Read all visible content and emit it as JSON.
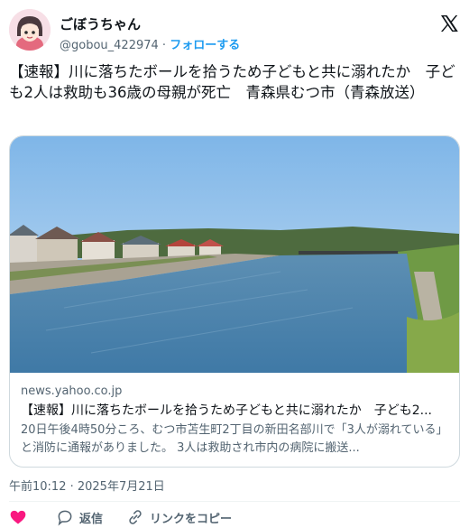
{
  "user": {
    "display_name": "ごぼうちゃん",
    "handle": "@gobou_422974",
    "separator": "·",
    "follow_label": "フォローする"
  },
  "tweet": {
    "text": "【速報】川に落ちたボールを拾うため子どもと共に溺れたか　子ども2人は救助も36歳の母親が死亡　青森県むつ市（青森放送）"
  },
  "card": {
    "domain": "news.yahoo.co.jp",
    "title": "【速報】川に落ちたボールを拾うため子どもと共に溺れたか　子ども2...",
    "description": "20日午後4時50分ころ、むつ市苫生町2丁目の新田名部川で「3人が溺れている」と消防に通報がありました。 3人は救助され市内の病院に搬送..."
  },
  "timestamp": "午前10:12 · 2025年7月21日",
  "actions": {
    "like_icon": "heart-icon",
    "reply_label": "返信",
    "copy_link_label": "リンクをコピー"
  },
  "colors": {
    "accent": "#1d9bf0",
    "like": "#f91880",
    "secondary_text": "#536471"
  }
}
